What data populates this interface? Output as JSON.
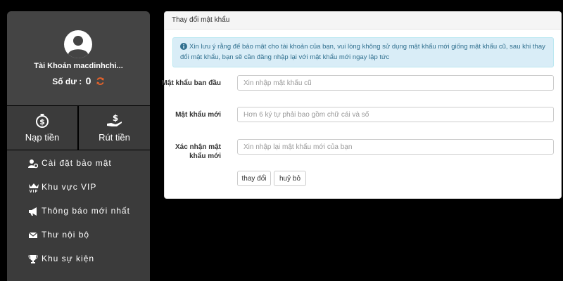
{
  "account": {
    "name": "Tài Khoản macdinhchi...",
    "balance_label": "Số dư :",
    "balance_value": "0"
  },
  "actions": {
    "deposit_label": "Nạp tiền",
    "withdraw_label": "Rút tiền"
  },
  "menu": {
    "items": [
      {
        "label": "Cài đặt bảo mật",
        "icon": "user-cog-icon"
      },
      {
        "label": "Khu vực VIP",
        "icon": "crown-vip-icon"
      },
      {
        "label": "Thông báo mới nhất",
        "icon": "bullhorn-icon"
      },
      {
        "label": "Thư nội bộ",
        "icon": "envelope-icon"
      },
      {
        "label": "Khu sự kiện",
        "icon": "trophy-icon"
      }
    ]
  },
  "panel": {
    "title": "Thay đổi mật khẩu",
    "notice": "Xin lưu ý rằng để bảo mật cho tài khoản của bạn, vui lòng không sử dụng mật khẩu mới giống mật khẩu cũ, sau khi thay đổi mật khẩu, bạn sẽ cần đăng nhập lại với mật khẩu mới ngay lập tức"
  },
  "form": {
    "old_password_label": "Mật khẩu ban đầu",
    "old_password_placeholder": "Xin nhập mật khẩu cũ",
    "new_password_label": "Mật khẩu mới",
    "new_password_placeholder": "Hơn 6 ký tự phải bao gồm chữ cái và số",
    "confirm_password_label": "Xác nhận mật khẩu mới",
    "confirm_password_placeholder": "Xin nhập lại mật khẩu mới của bạn",
    "change_button": "thay đổi",
    "cancel_button": "huỷ bỏ"
  },
  "colors": {
    "accent_refresh": "#e8632a",
    "notice_bg": "#d9edf7",
    "notice_text": "#31708f"
  }
}
